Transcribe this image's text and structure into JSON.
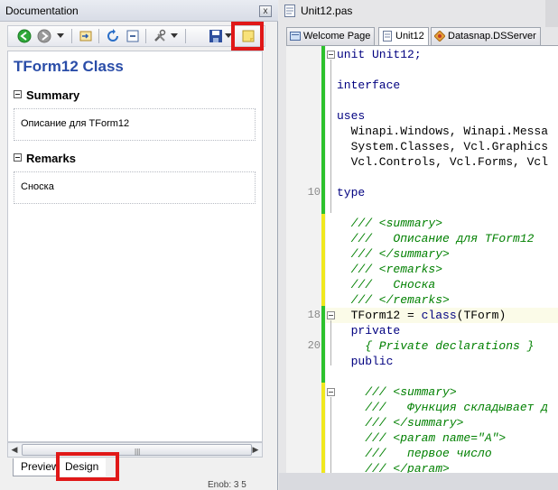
{
  "doc_panel": {
    "title": "Documentation",
    "close_glyph": "x",
    "toolbar": {
      "buttons": [
        "back-icon",
        "forward-icon",
        "dropdown-icon",
        "import-icon",
        "refresh-icon",
        "collapse-icon",
        "tools-icon",
        "dropdown-icon",
        "save-icon",
        "dropdown-icon",
        "note-icon"
      ]
    },
    "class_title": "TForm12 Class",
    "summary": {
      "heading": "Summary",
      "text": "Описание для TForm12"
    },
    "remarks": {
      "heading": "Remarks",
      "text": "Сноска"
    },
    "scroll": {
      "left": "◀",
      "right": "▶",
      "grip": "|||"
    },
    "tabs": {
      "preview": "Preview",
      "design": "Design"
    },
    "highlight_color": "#e01818"
  },
  "editor": {
    "window_title": "Unit12.pas",
    "tabs": [
      {
        "label": "Welcome Page",
        "active": false
      },
      {
        "label": "Unit12",
        "active": true
      },
      {
        "label": "Datasnap.DSServer",
        "active": false
      }
    ],
    "line_numbers": {
      "n10": "10",
      "n18": "18",
      "n20": "20"
    },
    "lines": {
      "l1": "unit Unit12;",
      "l3": "interface",
      "l5": "uses",
      "l6": "  Winapi.Windows, Winapi.Messa",
      "l7": "  System.Classes, Vcl.Graphics",
      "l8": "  Vcl.Controls, Vcl.Forms, Vcl",
      "l10": "type",
      "l12": "  /// <summary>",
      "l13": "  ///   Описание для TForm12",
      "l14": "  /// </summary>",
      "l15": "  /// <remarks>",
      "l16": "  ///   Сноска",
      "l17": "  /// </remarks>",
      "l18a": "  TForm12 = ",
      "l18b": "class",
      "l18c": "(TForm)",
      "l19": "  private",
      "l20": "    { Private declarations }",
      "l21": "  public",
      "l23": "    /// <summary>",
      "l24": "    ///   Функция складывает д",
      "l25": "    /// </summary>",
      "l26": "    /// <param name=\"A\">",
      "l27": "    ///   первое число",
      "l28": "    /// </param>"
    },
    "status_fragment": "Enob: 3 5",
    "colors": {
      "keyword": "#000080",
      "comment": "#008000",
      "saved_bar": "#2dc12d",
      "modified_bar": "#f0e81e"
    }
  }
}
